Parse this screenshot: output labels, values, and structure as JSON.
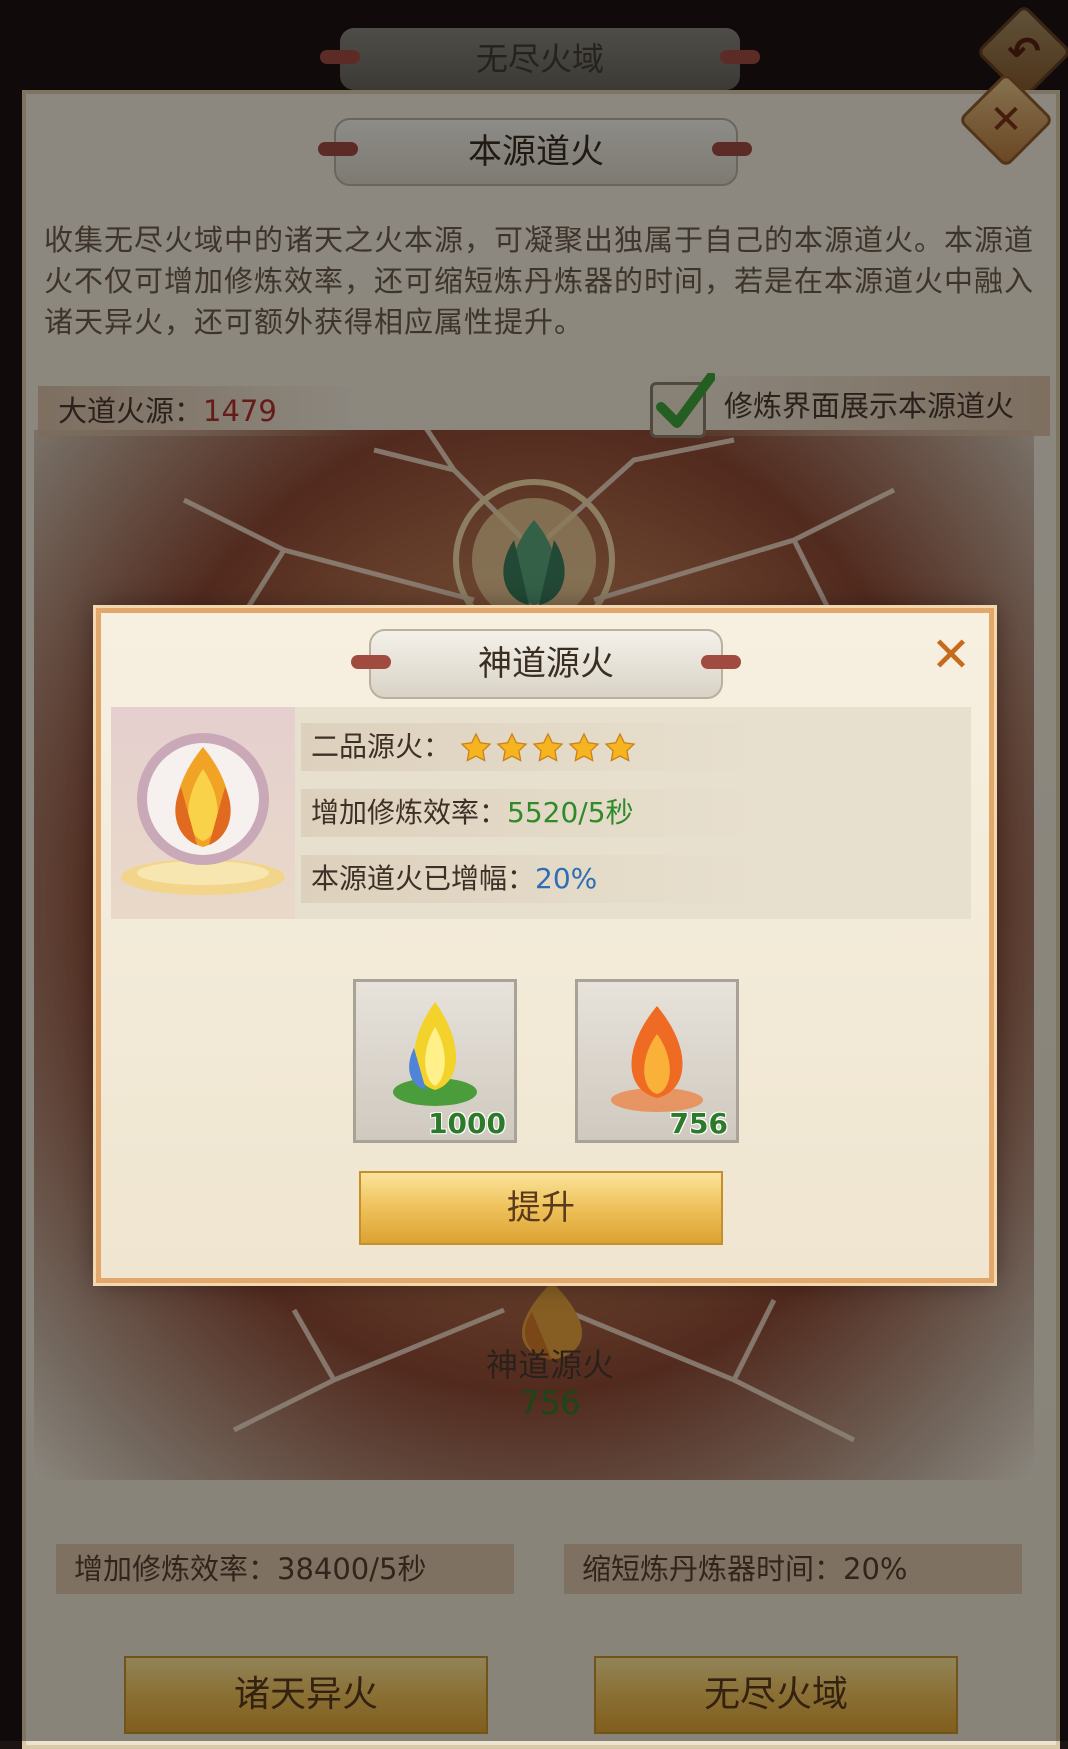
{
  "window": {
    "tab_title": "无尽火域"
  },
  "panel": {
    "title": "本源道火",
    "description": "收集无尽火域中的诸天之火本源，可凝聚出独属于自己的本源道火。本源道火不仅可增加修炼效率，还可缩短炼丹炼器的时间，若是在本源道火中融入诸天异火，还可额外获得相应属性提升。",
    "fire_source_label": "大道火源：",
    "fire_source_value": "1479",
    "show_toggle_label": "修炼界面展示本源道火",
    "show_toggle_checked": true,
    "center_fire_name": "神道源火",
    "center_fire_count": "756",
    "efficiency_stat": "增加修炼效率：38400/5秒",
    "time_stat": "缩短炼丹炼器时间：20%",
    "btn_foreign_fire": "诸天异火",
    "btn_endless_domain": "无尽火域"
  },
  "dialog": {
    "title": "神道源火",
    "grade_label": "二品源火：",
    "stars": 5,
    "efficiency_label": "增加修炼效率：",
    "efficiency_value": "5520/5秒",
    "boost_label": "本源道火已增幅：",
    "boost_value": "20%",
    "items": [
      {
        "icon": "green-gold-flame-item-icon",
        "count": "1000"
      },
      {
        "icon": "orange-flame-item-icon",
        "count": "756"
      }
    ],
    "upgrade_label": "提升"
  },
  "colors": {
    "fire_source_value": "#b0302a",
    "efficiency_value": "#2f8a2a",
    "boost_value": "#2f6db5",
    "close_x": "#c66a1c",
    "gold_button": "#eec15a"
  }
}
